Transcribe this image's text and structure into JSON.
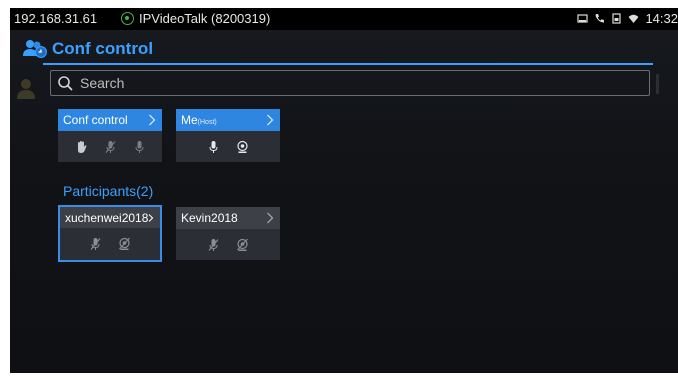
{
  "status_bar": {
    "ip": "192.168.31.61",
    "app_name": "IPVideoTalk (8200319)",
    "time": "14:32"
  },
  "header": {
    "title": "Conf control"
  },
  "search": {
    "placeholder": "Search"
  },
  "controls": [
    {
      "label": "Conf control",
      "sub": "",
      "icons": [
        "raise-hand-icon",
        "microphone-muted-icon",
        "microphone-icon"
      ]
    },
    {
      "label": "Me",
      "sub": "(Host)",
      "icons": [
        "microphone-icon",
        "camera-icon"
      ]
    }
  ],
  "participants": {
    "heading": "Participants(2)",
    "items": [
      {
        "name": "xuchenwei2018",
        "icons": [
          "microphone-muted-icon",
          "camera-off-icon"
        ]
      },
      {
        "name": "Kevin2018",
        "icons": [
          "microphone-muted-icon",
          "camera-off-icon"
        ]
      }
    ]
  },
  "colors": {
    "accent": "#3aa0ff",
    "card_blue": "#2f86e0",
    "card_gray": "#3d4047",
    "background": "#111317"
  }
}
